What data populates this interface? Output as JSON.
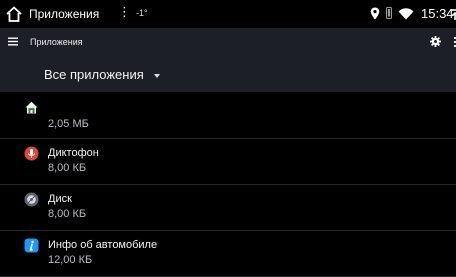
{
  "status_bar": {
    "title": "Приложения",
    "menu_dots": "⋮",
    "temperature": "-1°",
    "time": "15:34",
    "icons": [
      "home-icon",
      "location-icon",
      "vibrate-icon",
      "wifi-icon",
      "upload-icon"
    ]
  },
  "app_bar": {
    "title": "Приложения",
    "icons": [
      "hamburger-menu-icon",
      "gear-icon",
      "more-vert-icon"
    ]
  },
  "filter": {
    "selected": "Все приложения"
  },
  "apps": [
    {
      "name": "",
      "size": "2,05 МБ",
      "icon": "home-app-icon",
      "icon_color": "#2e7d32"
    },
    {
      "name": "Диктофон",
      "size": "8,00 КБ",
      "icon": "microphone-icon",
      "icon_color": "#d84a3a"
    },
    {
      "name": "Диск",
      "size": "8,00 КБ",
      "icon": "disc-icon",
      "icon_color": "#5f6470"
    },
    {
      "name": "Инфо об автомобиле",
      "size": "12,00 КБ",
      "icon": "car-info-icon",
      "icon_color": "#2196f3"
    }
  ],
  "colors": {
    "background": "#000000",
    "toolbar": "#1c2026",
    "divider": "#23272d",
    "text_primary": "#f3f3f3",
    "text_secondary": "#b8bcc2"
  }
}
